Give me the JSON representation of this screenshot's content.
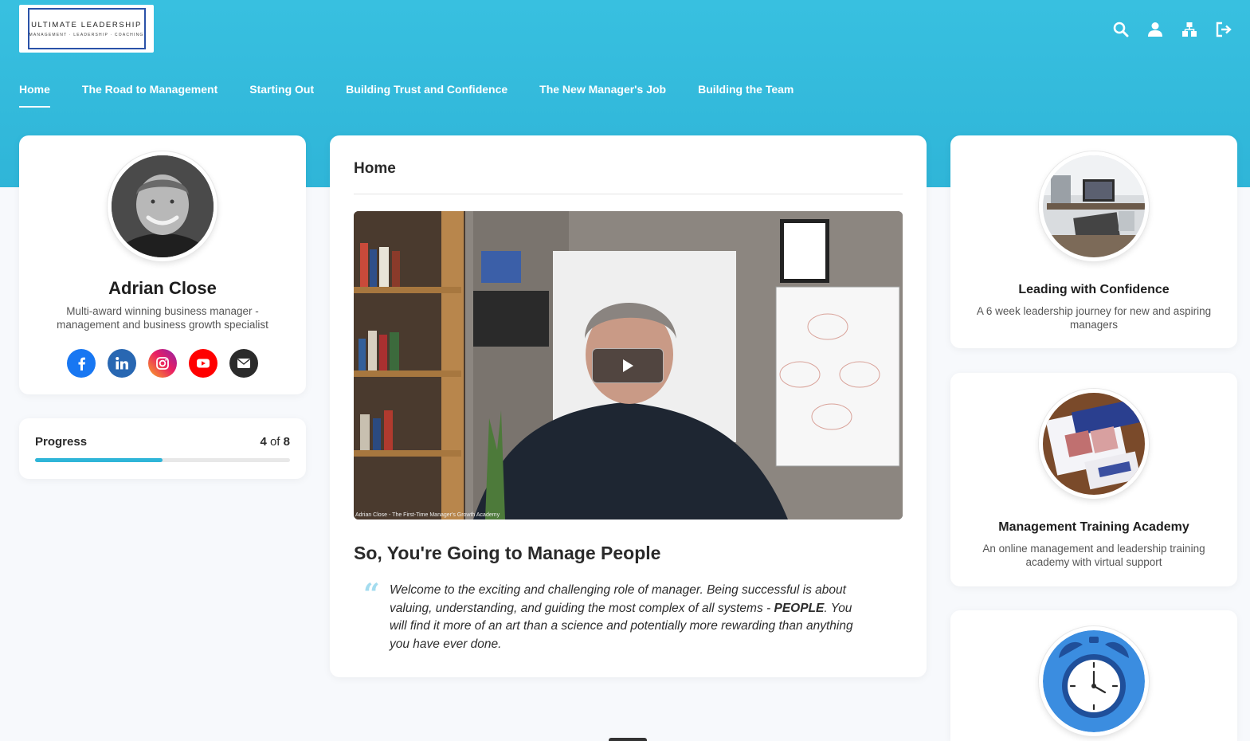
{
  "brand": {
    "logo_title": "ULTIMATE LEADERSHIP",
    "logo_subtitle": "MANAGEMENT · LEADERSHIP · COACHING"
  },
  "header_icons": [
    "search-icon",
    "user-icon",
    "sitemap-icon",
    "logout-icon"
  ],
  "nav": {
    "items": [
      {
        "label": "Home",
        "active": true
      },
      {
        "label": "The Road to Management",
        "active": false
      },
      {
        "label": "Starting Out",
        "active": false
      },
      {
        "label": "Building Trust and Confidence",
        "active": false
      },
      {
        "label": "The New Manager's Job",
        "active": false
      },
      {
        "label": "Building the Team",
        "active": false
      }
    ]
  },
  "profile": {
    "name": "Adrian Close",
    "bio": "Multi-award winning business manager - management and business growth specialist",
    "socials": [
      {
        "icon": "facebook-icon",
        "color": "#1877f2"
      },
      {
        "icon": "linkedin-icon",
        "color": "#2867b2"
      },
      {
        "icon": "instagram-icon",
        "color": "#d6249f"
      },
      {
        "icon": "youtube-icon",
        "color": "#ff0000"
      },
      {
        "icon": "email-icon",
        "color": "#2b2b2b"
      }
    ]
  },
  "progress": {
    "label": "Progress",
    "current": "4",
    "of_text": "of",
    "total": "8",
    "fraction": 0.5
  },
  "main": {
    "title": "Home",
    "video_caption": "Adrian Close - The First-Time Manager's Growth Academy",
    "heading": "So, You're Going to Manage People",
    "quote_mark": "“",
    "quote_before": "Welcome to the exciting and challenging role of manager. Being successful is about valuing, understanding, and guiding the most complex of all systems - ",
    "quote_bold": "PEOPLE",
    "quote_after": ". You will find it more of an art than a science and potentially more rewarding than anything you have ever done."
  },
  "courses": [
    {
      "title": "Leading with Confidence",
      "description": "A 6 week leadership journey for new and aspiring managers"
    },
    {
      "title": "Management Training Academy",
      "description": "An online management and leadership training academy with virtual support"
    },
    {
      "title": "",
      "description": ""
    }
  ],
  "colors": {
    "header": "#38c0e0",
    "accent": "#2fb5d8",
    "page_bg": "#f7f9fc"
  }
}
